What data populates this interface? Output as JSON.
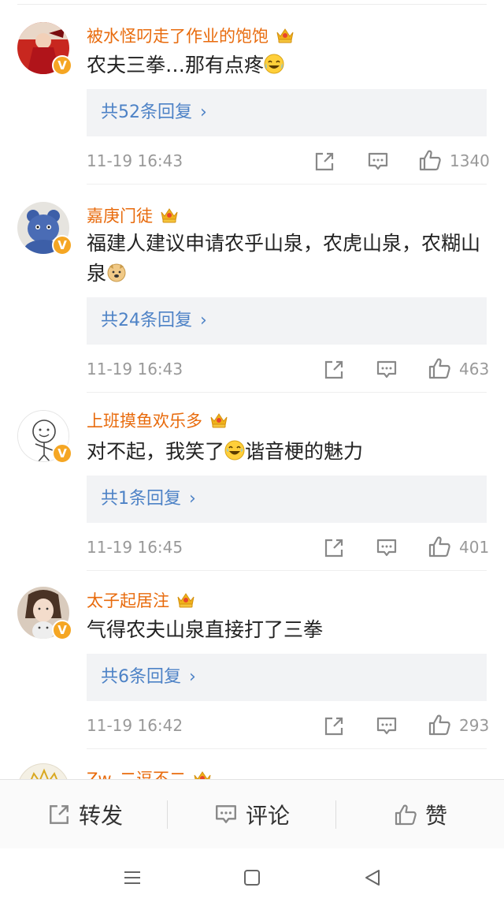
{
  "comments": [
    {
      "username": "被水怪叼走了作业的饱饱",
      "text": "农夫三拳…那有点疼",
      "reply_label": "共52条回复",
      "time": "11-19 16:43",
      "likes": "1340"
    },
    {
      "username": "嘉庚门徒",
      "text": "福建人建议申请农乎山泉，农虎山泉，农糊山泉",
      "reply_label": "共24条回复",
      "time": "11-19 16:43",
      "likes": "463"
    },
    {
      "username": "上班摸鱼欢乐多",
      "text_before": "对不起，我笑了",
      "text_after": "谐音梗的魅力",
      "reply_label": "共1条回复",
      "time": "11-19 16:45",
      "likes": "401"
    },
    {
      "username": "太子起居注",
      "text": "气得农夫山泉直接打了三拳",
      "reply_label": "共6条回复",
      "time": "11-19 16:42",
      "likes": "293"
    }
  ],
  "partial_username": "Zw_二逗不二",
  "bottom_bar": {
    "repost": "转发",
    "comment": "评论",
    "like": "赞"
  },
  "colors": {
    "username": "#e86b0d",
    "reply_link": "#4d82c6",
    "meta": "#999999",
    "badge": "#f5a623"
  },
  "icons": [
    "crown-badge-icon",
    "verified-v-icon",
    "share-icon",
    "comment-icon",
    "thumbs-up-icon",
    "menu-icon",
    "home-square-icon",
    "back-triangle-icon"
  ]
}
